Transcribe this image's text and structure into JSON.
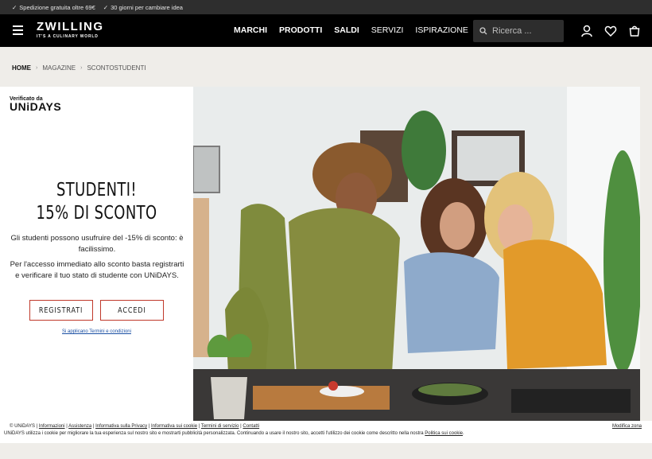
{
  "topbar": {
    "items": [
      "Spedizione gratuita oltre 69€",
      "30 giorni per cambiare idea"
    ]
  },
  "header": {
    "brand": "ZWILLING",
    "tagline": "IT'S A CULINARY WORLD",
    "nav": [
      "MARCHI",
      "PRODOTTI",
      "SALDI",
      "SERVIZI",
      "ISPIRAZIONE"
    ],
    "search_placeholder": "Ricerca ..."
  },
  "breadcrumb": [
    "HOME",
    "MAGAZINE",
    "SCONTOSTUDENTI"
  ],
  "promo": {
    "verified_by": "Verificato da",
    "partner": "UNiDAYS",
    "heading_line1": "STUDENTI!",
    "heading_line2": "15% DI SCONTO",
    "desc1": "Gli studenti possono usufruire del -15% di sconto: è facilissimo.",
    "desc2": "Per l'accesso immediato allo sconto basta registrarti e verificare il tuo stato di studente con UNiDAYS.",
    "register_label": "REGISTRATI",
    "login_label": "ACCEDI",
    "terms_link": "Si applicano Termini e condizioni"
  },
  "footer": {
    "copyright": "© UNiDAYS",
    "links": [
      "Informazioni",
      "Assistenza",
      "Informativa sulla Privacy",
      "Informativa sui cookie",
      "Termini di servizio",
      "Contatti"
    ],
    "cookie_text": "UNiDAYS utilizza i cookie per migliorare la tua esperienza sul nostro sito e mostrarti pubblicità personalizzata. Continuando a usare il nostro sito, accetti l'utilizzo dei cookie come descritto nella nostra",
    "cookie_link": "Politica sui cookie",
    "change_zone": "Modifica zona"
  },
  "colors": {
    "accent_border": "#c0392b",
    "header_bg": "#000000",
    "page_bg": "#efede9"
  }
}
